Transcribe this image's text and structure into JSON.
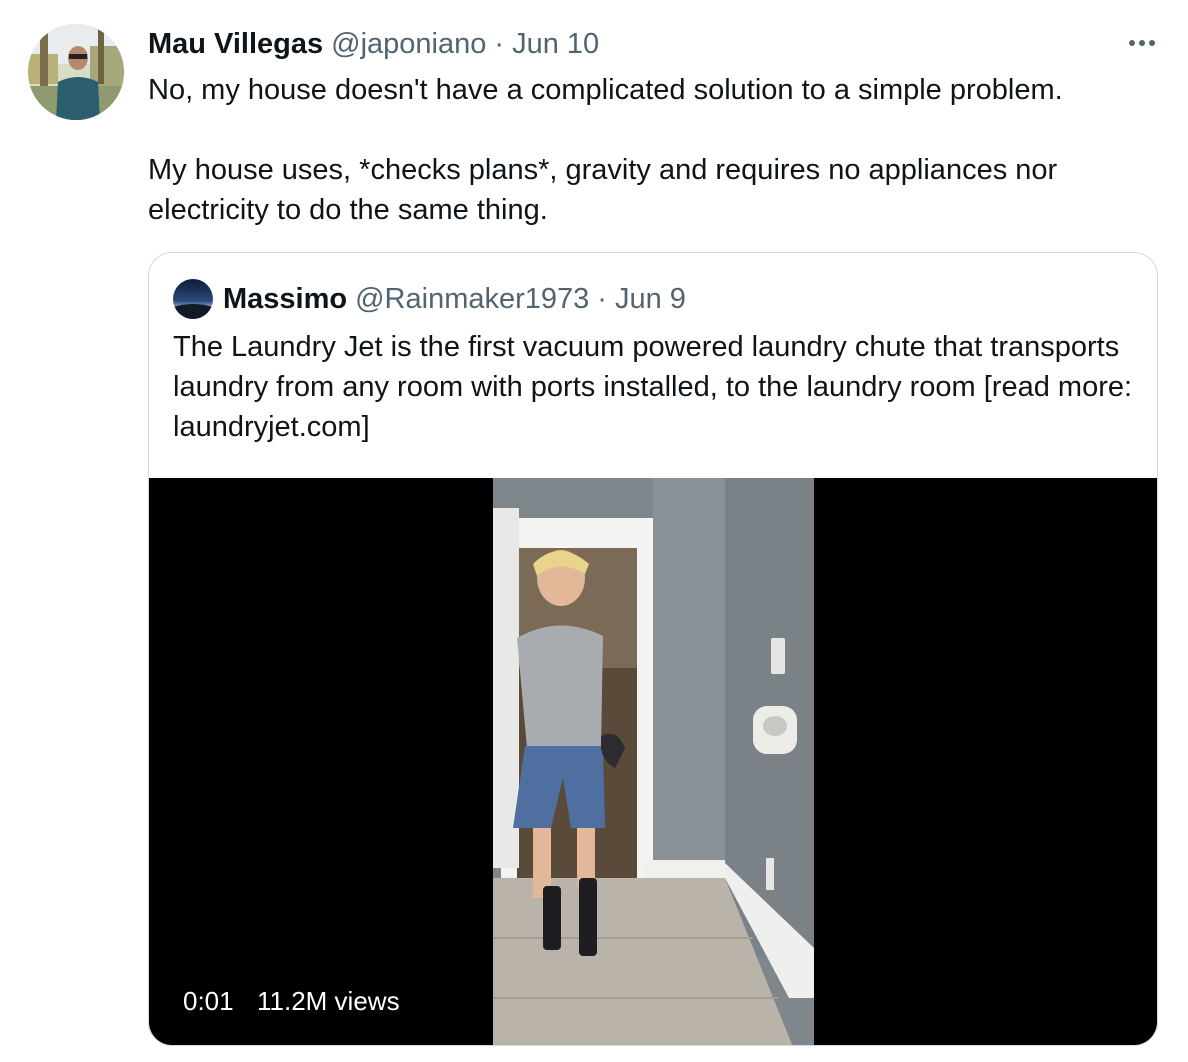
{
  "tweet": {
    "author_name": "Mau Villegas",
    "author_handle": "@japoniano",
    "separator": "·",
    "date": "Jun 10",
    "more_icon": "more-horizontal-icon",
    "paragraphs": [
      "No, my house doesn't have a complicated solution to a simple problem.",
      "My house uses, *checks plans*, gravity and requires no appliances nor electricity to do the same thing."
    ]
  },
  "quoted_tweet": {
    "author_name": "Massimo",
    "author_handle": "@Rainmaker1973",
    "separator": "·",
    "date": "Jun 9",
    "text": "The Laundry Jet is the first vacuum powered laundry chute that transports laundry from any room with ports installed, to the laundry room [read more: laundryjet.com]",
    "video": {
      "elapsed_time": "0:01",
      "views": "11.2M views"
    }
  },
  "colors": {
    "text_primary": "#0f1419",
    "text_secondary": "#536471",
    "border": "#cfd9de",
    "video_background": "#000000"
  }
}
